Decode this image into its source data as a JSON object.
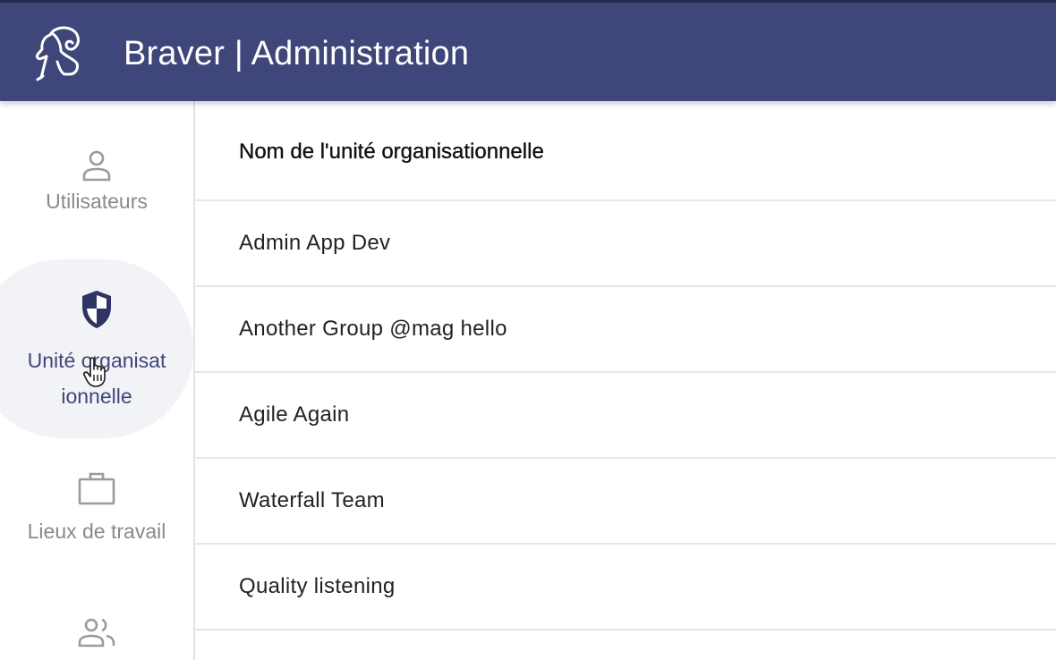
{
  "header": {
    "title": "Braver | Administration",
    "logo_icon": "ram-icon",
    "background": "#3f4679"
  },
  "sidebar": {
    "items": [
      {
        "label": "Utilisateurs",
        "icon": "person-icon",
        "active": false
      },
      {
        "label_line1": "Unité organisat",
        "label_line2": "ionnelle",
        "icon": "shield-icon",
        "active": true
      },
      {
        "label": "Lieux de travail",
        "icon": "briefcase-icon",
        "active": false
      },
      {
        "icon": "group-icon",
        "active": false
      }
    ],
    "active_color": "#3f4679",
    "inactive_color": "#8a8a8a"
  },
  "table": {
    "column_header": "Nom de l'unité organisationnelle",
    "rows": [
      "Admin App Dev",
      "Another Group @mag hello",
      "Agile Again",
      "Waterfall Team",
      "Quality listening"
    ]
  }
}
